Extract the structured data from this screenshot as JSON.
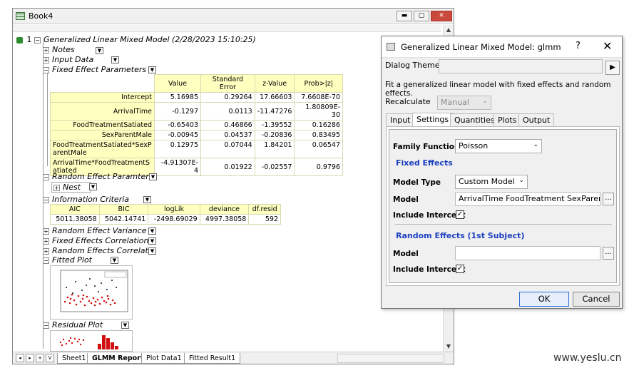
{
  "window": {
    "title": "Book4"
  },
  "report": {
    "root_index": "1",
    "root_title": "Generalized Linear Mixed Model (2/28/2023 15:10:25)",
    "nodes": {
      "notes": "Notes",
      "input_data": "Input Data",
      "fixed_effect_parameters": "Fixed Effect Parameters",
      "random_effect_parameters": "Random Effect Paramters",
      "nest": "Nest",
      "information_criteria": "Information Criteria",
      "random_effect_variance": "Random Effect Variance",
      "fixed_effects_correlation": "Fixed Effects Correlation",
      "random_effects_correlation": "Random Effects Correlatio",
      "fitted_plot": "Fitted Plot",
      "residual_plot": "Residual Plot"
    },
    "fixed_table": {
      "headers": [
        "Value",
        "Standard Error",
        "z-Value",
        "Prob>|z|"
      ],
      "rows": [
        {
          "label": "Intercept",
          "cells": [
            "5.16985",
            "0.29264",
            "17.66603",
            "7.6608E-70"
          ]
        },
        {
          "label": "ArrivalTime",
          "cells": [
            "-0.1297",
            "0.0113",
            "-11.47276",
            "1.80809E-30"
          ]
        },
        {
          "label": "FoodTreatmentSatiated",
          "cells": [
            "-0.65403",
            "0.46866",
            "-1.39552",
            "0.16286"
          ]
        },
        {
          "label": "SexParentMale",
          "cells": [
            "-0.00945",
            "0.04537",
            "-0.20836",
            "0.83495"
          ]
        },
        {
          "label": "FoodTreatmentSatiated*SexParentMale",
          "cells": [
            "0.12975",
            "0.07044",
            "1.84201",
            "0.06547"
          ]
        },
        {
          "label": "ArrivalTime*FoodTreatmentSatiated",
          "cells": [
            "-4.91307E-4",
            "0.01922",
            "-0.02557",
            "0.9796"
          ]
        }
      ]
    },
    "ic_table": {
      "headers": [
        "AIC",
        "BIC",
        "logLik",
        "deviance",
        "df.resid"
      ],
      "values": [
        "5011.38058",
        "5042.14741",
        "-2498.69029",
        "4997.38058",
        "592"
      ]
    }
  },
  "sheet_tabs": [
    "Sheet1",
    "GLMM Report",
    "Plot Data1",
    "Fitted Result1"
  ],
  "sheet_nav": [
    "◂",
    "▸",
    "+",
    "V"
  ],
  "dialog": {
    "title": "Generalized Linear Mixed Model: glmm",
    "help_glyph": "?",
    "close_glyph": "✕",
    "dialog_theme_label": "Dialog Theme",
    "dialog_theme_value": "",
    "description": "Fit a generalized linear model with fixed effects and random effects.",
    "recalculate_label": "Recalculate",
    "recalculate_value": "Manual",
    "tabs": [
      "Input",
      "Settings",
      "Quantities",
      "Plots",
      "Output"
    ],
    "active_tab": "Settings",
    "family_function_label": "Family Function",
    "family_function_value": "Poisson",
    "fixed_effects_header": "Fixed Effects",
    "model_type_label": "Model Type",
    "model_type_value": "Custom Model",
    "model_label": "Model",
    "model_value": "ArrivalTime FoodTreatment SexParent Fo",
    "include_intercept_label": "Include Intercept",
    "include_intercept_fixed": true,
    "random_effects_header": "Random Effects (1st Subject)",
    "random_model_label": "Model",
    "random_model_value": "",
    "include_intercept_random": true,
    "ellipsis": "...",
    "ok_label": "OK",
    "cancel_label": "Cancel"
  },
  "watermark": "www.yeslu.cn"
}
